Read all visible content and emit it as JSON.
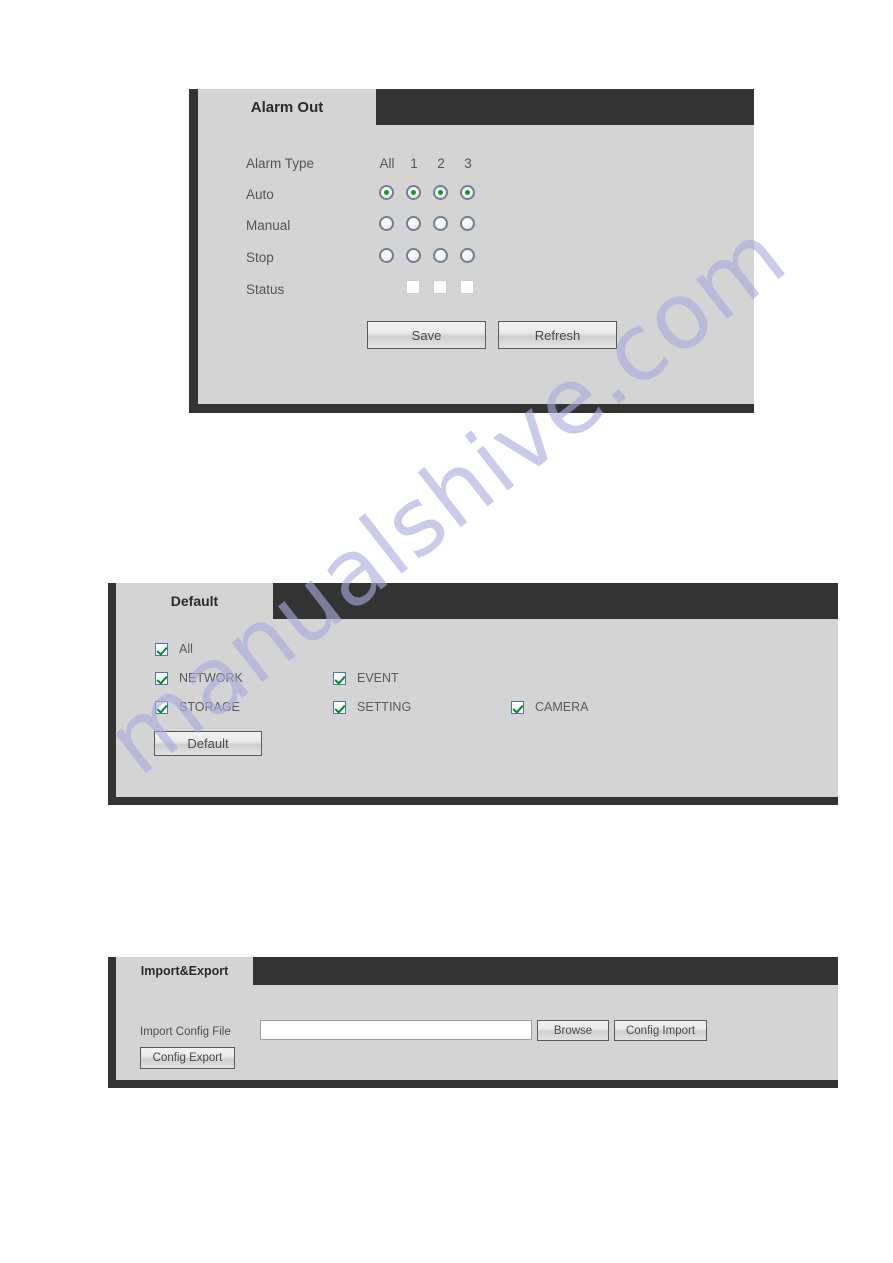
{
  "watermark": {
    "text": "manualshive.com",
    "color": "#aaaadf"
  },
  "panels": {
    "alarm_out": {
      "tab_label": "Alarm Out",
      "rows": [
        {
          "label": "Alarm Type"
        },
        {
          "label": "Auto"
        },
        {
          "label": "Manual"
        },
        {
          "label": "Stop"
        },
        {
          "label": "Status"
        }
      ],
      "columns": [
        "All",
        "1",
        "2",
        "3"
      ],
      "radio_states": {
        "auto": [
          true,
          true,
          true,
          true
        ],
        "manual": [
          false,
          false,
          false,
          false
        ],
        "stop": [
          false,
          false,
          false,
          false
        ]
      },
      "status_boxes": [
        "1",
        "2",
        "3"
      ],
      "buttons": {
        "save": "Save",
        "refresh": "Refresh"
      }
    },
    "default": {
      "tab_label": "Default",
      "checkboxes": [
        {
          "label": "All",
          "checked": true
        },
        {
          "label": "NETWORK",
          "checked": true
        },
        {
          "label": "EVENT",
          "checked": true
        },
        {
          "label": "STORAGE",
          "checked": true
        },
        {
          "label": "SETTING",
          "checked": true
        },
        {
          "label": "CAMERA",
          "checked": true
        }
      ],
      "buttons": {
        "default": "Default"
      }
    },
    "import_export": {
      "tab_label": "Import&Export",
      "field_label": "Import Config File",
      "field_value": "",
      "field_placeholder": "",
      "buttons": {
        "browse": "Browse",
        "config_import": "Config Import",
        "config_export": "Config Export"
      }
    }
  }
}
